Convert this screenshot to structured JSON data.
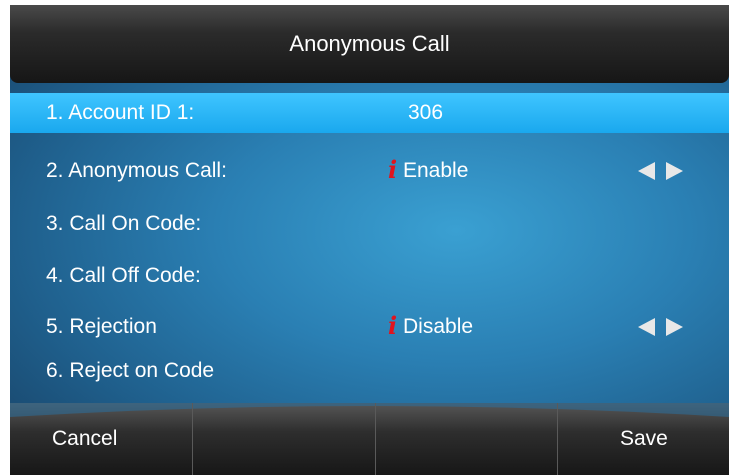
{
  "title": "Anonymous Call",
  "rows": [
    {
      "label": "1. Account ID 1:",
      "value": "306",
      "selected": true
    },
    {
      "label": "2. Anonymous Call:",
      "value": "Enable",
      "info_icon": "i",
      "arrows": true
    },
    {
      "label": "3. Call On Code:",
      "value": ""
    },
    {
      "label": "4. Call Off Code:",
      "value": ""
    },
    {
      "label": "5. Rejection",
      "value": "Disable",
      "info_icon": "i",
      "arrows": true
    },
    {
      "label": "6. Reject on Code",
      "value": ""
    }
  ],
  "softkeys": [
    "Cancel",
    "",
    "",
    "Save"
  ],
  "colors": {
    "selected_row": "#1aa8ee",
    "background": "#2a7fb3",
    "info_icon": "#e0141e",
    "title_bar": "#1e1e1e"
  }
}
